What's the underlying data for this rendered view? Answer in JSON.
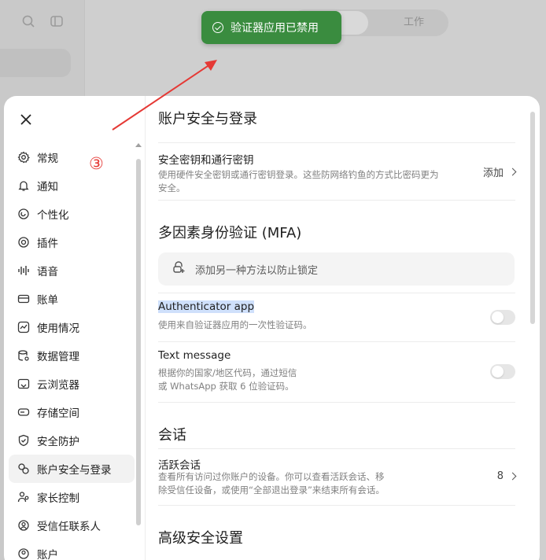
{
  "toast": {
    "message": "验证器应用已禁用",
    "color": "#3a8c3f"
  },
  "annotation": {
    "number": "③",
    "color": "#e53935"
  },
  "background": {
    "tabs": [
      "",
      "工作"
    ]
  },
  "nav": {
    "items": [
      {
        "label": "常规",
        "icon": "gear-icon"
      },
      {
        "label": "通知",
        "icon": "bell-icon"
      },
      {
        "label": "个性化",
        "icon": "personalize-icon"
      },
      {
        "label": "插件",
        "icon": "plugin-icon"
      },
      {
        "label": "语音",
        "icon": "voice-icon"
      },
      {
        "label": "账单",
        "icon": "card-icon"
      },
      {
        "label": "使用情况",
        "icon": "usage-icon"
      },
      {
        "label": "数据管理",
        "icon": "database-icon"
      },
      {
        "label": "云浏览器",
        "icon": "cloud-browser-icon"
      },
      {
        "label": "存储空间",
        "icon": "storage-icon"
      },
      {
        "label": "安全防护",
        "icon": "shield-icon"
      },
      {
        "label": "账户安全与登录",
        "icon": "key-icon",
        "active": true
      },
      {
        "label": "家长控制",
        "icon": "parental-icon"
      },
      {
        "label": "受信任联系人",
        "icon": "trusted-contact-icon"
      },
      {
        "label": "账户",
        "icon": "account-icon"
      }
    ]
  },
  "content": {
    "title": "账户安全与登录",
    "passkeys": {
      "title": "安全密钥和通行密钥",
      "desc_line1": "使用硬件安全密钥或通行密钥登录。这些防网络钓鱼的方式比密码更为",
      "desc_line2": "安全。",
      "action": "添加"
    },
    "mfa": {
      "title": "多因素身份验证 (MFA)",
      "add_method": "添加另一种方法以防止锁定",
      "authenticator": {
        "title": "Authenticator app",
        "desc": "使用来自验证器应用的一次性验证码。",
        "enabled": false
      },
      "sms": {
        "title": "Text message",
        "desc_line1": "根据你的国家/地区代码，通过短信",
        "desc_line2": "或 WhatsApp 获取 6 位验证码。",
        "enabled": false
      }
    },
    "sessions": {
      "title": "会话",
      "active_title": "活跃会话",
      "desc_line1": "查看所有访问过你账户的设备。你可以查看活跃会话、移",
      "desc_line2": "除受信任设备，或使用“全部退出登录”来结束所有会话。",
      "count": "8"
    },
    "advanced": {
      "title": "高级安全设置"
    }
  }
}
